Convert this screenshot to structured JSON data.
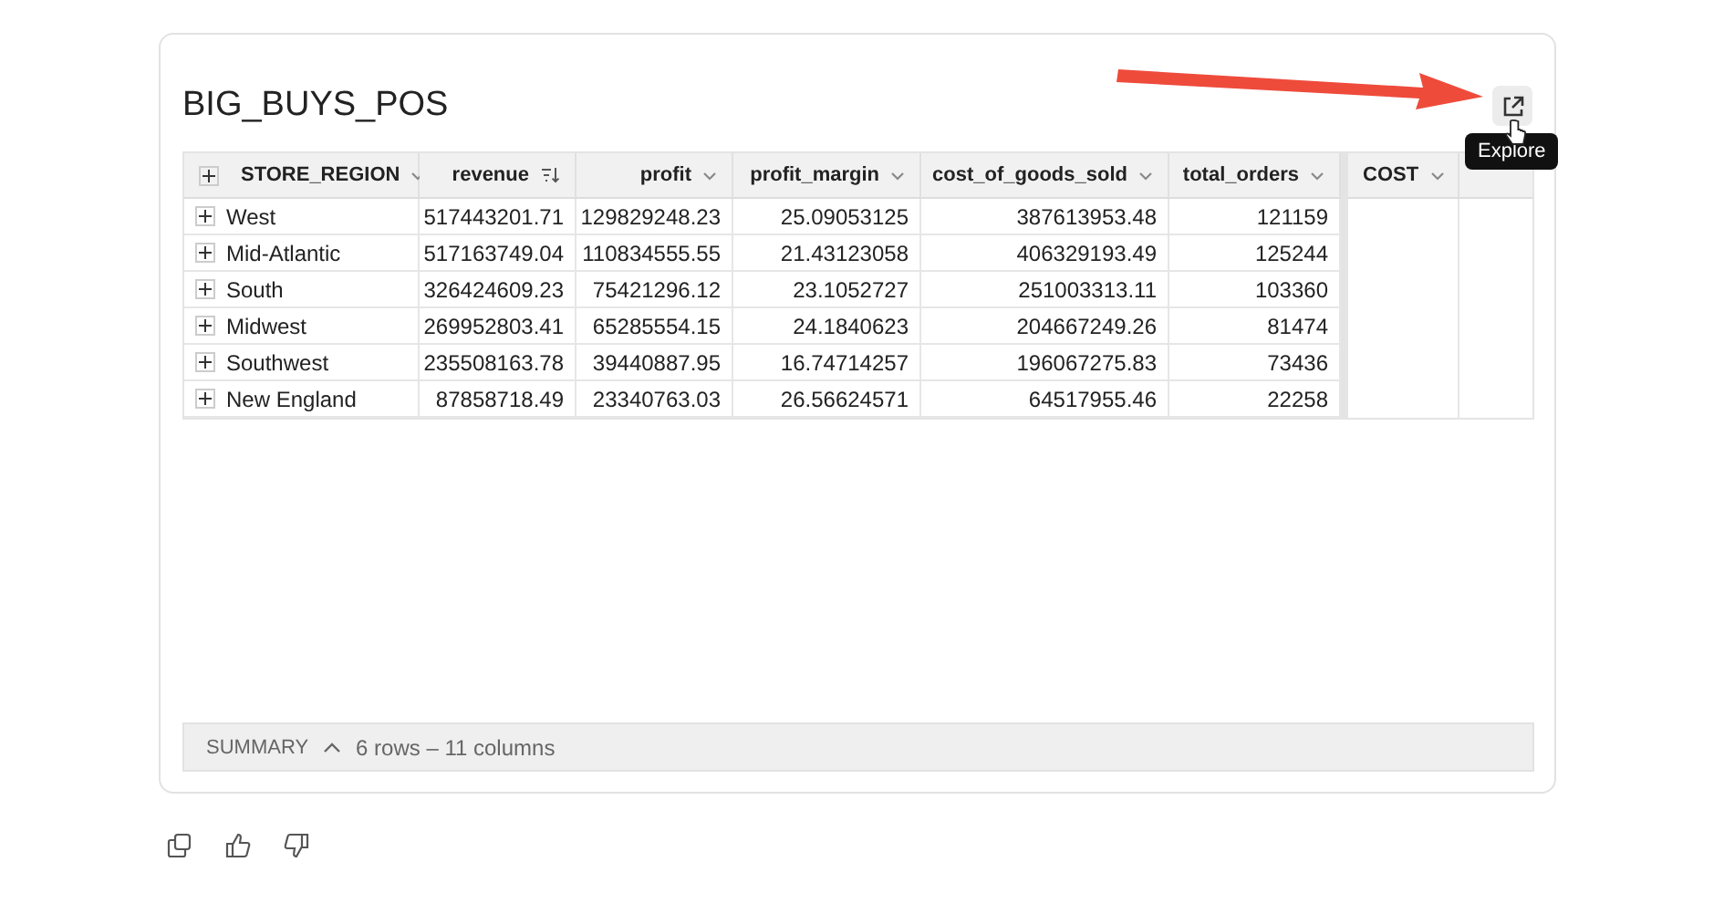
{
  "card": {
    "title": "BIG_BUYS_POS",
    "explore_button": {
      "tooltip": "Explore"
    }
  },
  "table": {
    "columns": [
      {
        "label": "STORE_REGION",
        "kind": "text",
        "sorted": false
      },
      {
        "label": "revenue",
        "kind": "number",
        "sorted": true
      },
      {
        "label": "profit",
        "kind": "number",
        "sorted": false
      },
      {
        "label": "profit_margin",
        "kind": "number",
        "sorted": false
      },
      {
        "label": "cost_of_goods_sold",
        "kind": "number",
        "sorted": false
      },
      {
        "label": "total_orders",
        "kind": "number",
        "sorted": false
      }
    ],
    "pinned_columns": [
      {
        "label": "COST",
        "sorted": false
      }
    ],
    "rows": [
      [
        "West",
        "517443201.71",
        "129829248.23",
        "25.09053125",
        "387613953.48",
        "121159"
      ],
      [
        "Mid-Atlantic",
        "517163749.04",
        "110834555.55",
        "21.43123058",
        "406329193.49",
        "125244"
      ],
      [
        "South",
        "326424609.23",
        "75421296.12",
        "23.1052727",
        "251003313.11",
        "103360"
      ],
      [
        "Midwest",
        "269952803.41",
        "65285554.15",
        "24.1840623",
        "204667249.26",
        "81474"
      ],
      [
        "Southwest",
        "235508163.78",
        "39440887.95",
        "16.74714257",
        "196067275.83",
        "73436"
      ],
      [
        "New England",
        "87858718.49",
        "23340763.03",
        "26.56624571",
        "64517955.46",
        "22258"
      ]
    ]
  },
  "summary": {
    "label": "SUMMARY",
    "expanded": true,
    "text": "6 rows – 11 columns"
  },
  "feedback": [
    {
      "kind": "copy"
    },
    {
      "kind": "like"
    },
    {
      "kind": "dislike"
    }
  ]
}
